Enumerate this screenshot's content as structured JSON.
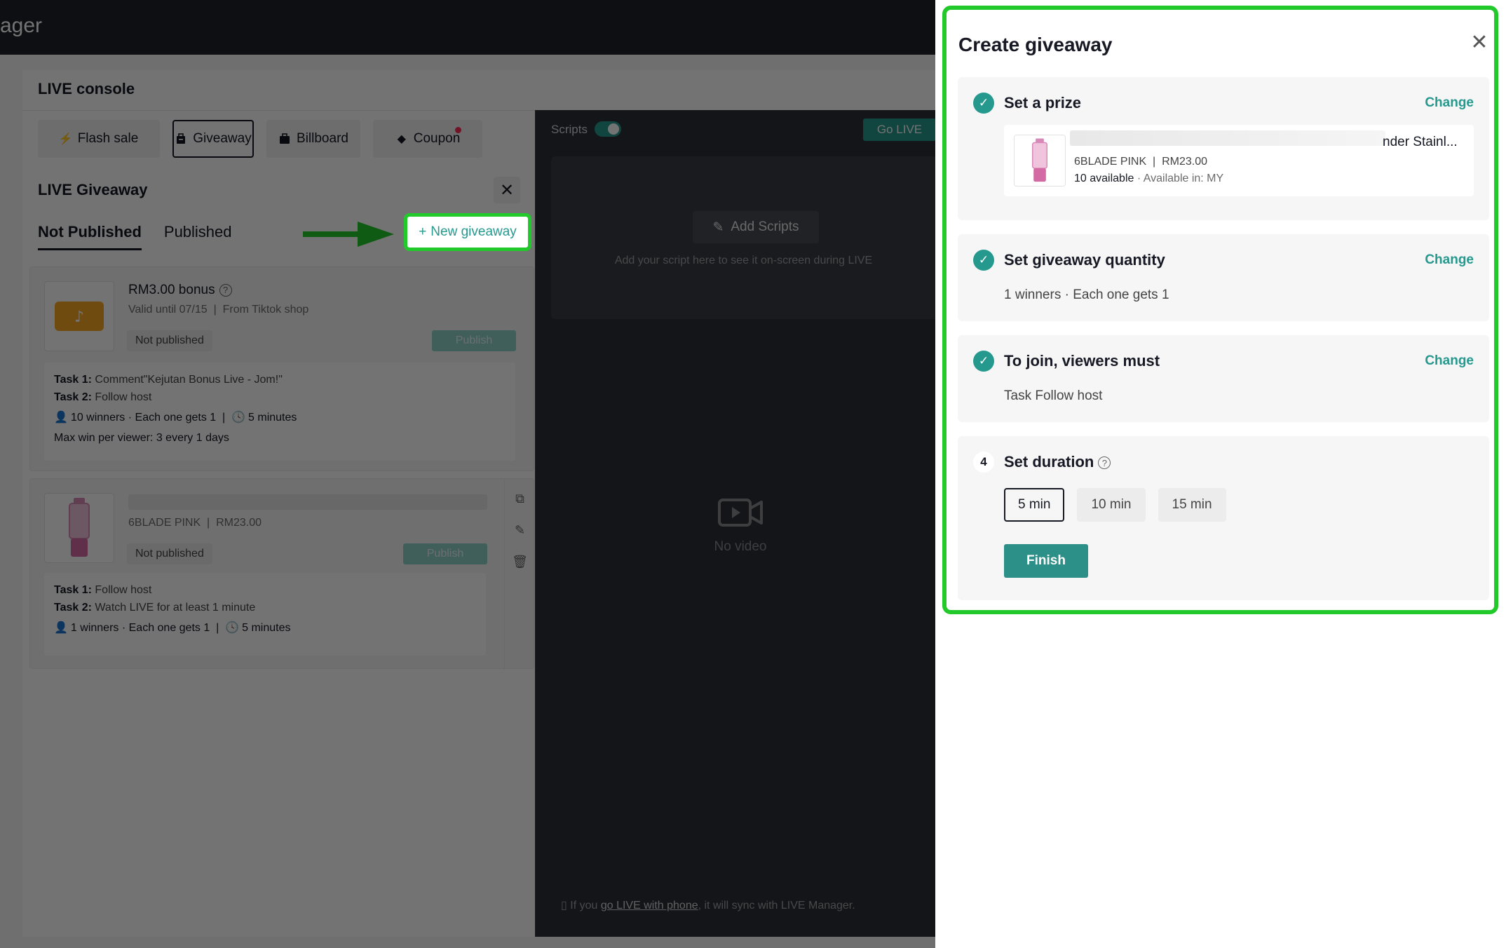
{
  "topbar": {
    "brand": "ager"
  },
  "console": {
    "title": "LIVE console",
    "tools": [
      {
        "label": "Flash sale",
        "icon": "lightning-icon"
      },
      {
        "label": "Giveaway",
        "icon": "gift-bag-icon"
      },
      {
        "label": "Billboard",
        "icon": "billboard-icon"
      },
      {
        "label": "Coupon",
        "icon": "coupon-icon"
      }
    ]
  },
  "live_giveaway": {
    "title": "LIVE Giveaway",
    "tabs": [
      "Not Published",
      "Published"
    ],
    "new_giveaway": "New giveaway",
    "cards": [
      {
        "name": "RM3.00 bonus",
        "valid": "Valid until 07/15",
        "source": "From Tiktok shop",
        "status": "Not published",
        "publish": "Publish",
        "task1_label": "Task 1:",
        "task1": "Comment\"Kejutan Bonus Live - Jom!\"",
        "task2_label": "Task 2:",
        "task2": "Follow host",
        "winners": "10 winners · Each one gets 1",
        "duration": "5 minutes",
        "max_win": "Max win per viewer: 3 every 1 days"
      },
      {
        "variant": "6BLADE PINK",
        "price": "RM23.00",
        "status": "Not published",
        "publish": "Publish",
        "task1_label": "Task 1:",
        "task1": "Follow host",
        "task2_label": "Task 2:",
        "task2": "Watch LIVE for at least 1 minute",
        "winners": "1 winners · Each one gets 1",
        "duration": "5 minutes"
      }
    ]
  },
  "scripts": {
    "label": "Scripts",
    "go_live": "Go LIVE",
    "add_scripts": "Add Scripts",
    "hint": "Add your script here to see it on-screen during LIVE",
    "no_video": "No video",
    "phone_prefix": "If you ",
    "phone_link": "go LIVE with phone",
    "phone_suffix": ", it will sync with LIVE Manager."
  },
  "drawer": {
    "title": "Create giveaway",
    "change_label": "Change",
    "step1": {
      "title": "Set a prize",
      "product_title": "nder Stainl...",
      "variant": "6BLADE PINK",
      "price": "RM23.00",
      "available": "10 available",
      "region": "Available in: MY"
    },
    "step2": {
      "title": "Set giveaway quantity",
      "desc": "1 winners · Each one gets 1"
    },
    "step3": {
      "title": "To join, viewers must",
      "desc": "Task Follow host"
    },
    "step4": {
      "number": "4",
      "title": "Set duration",
      "options": [
        "5 min",
        "10 min",
        "15 min"
      ],
      "selected": "5 min",
      "finish": "Finish"
    }
  },
  "colors": {
    "accent": "#26998f",
    "highlight": "#22c92a",
    "topbar": "#1f2228"
  }
}
